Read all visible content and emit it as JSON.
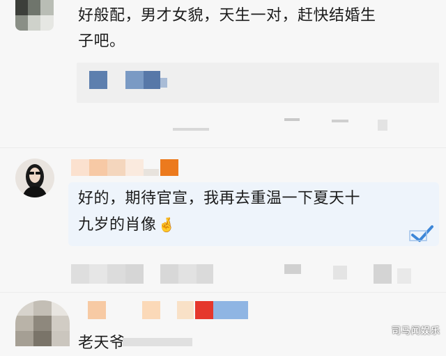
{
  "comments": [
    {
      "text_line1": "好般配，男才女貌，天生一对，赶快结婚生",
      "text_line2": "子吧。"
    },
    {
      "text_line1": "好的，期待官宣，我再去重温一下夏天十",
      "text_line2": "九岁的肖像",
      "emoji": "🤞"
    },
    {
      "text_line1": "老天爷"
    }
  ],
  "watermark": "司马闻娱乐",
  "colors": {
    "background": "#f7f7f7",
    "text": "#1b1b1b",
    "bubble": "#eef4fb",
    "accent_blue": "#5b7fb3"
  }
}
